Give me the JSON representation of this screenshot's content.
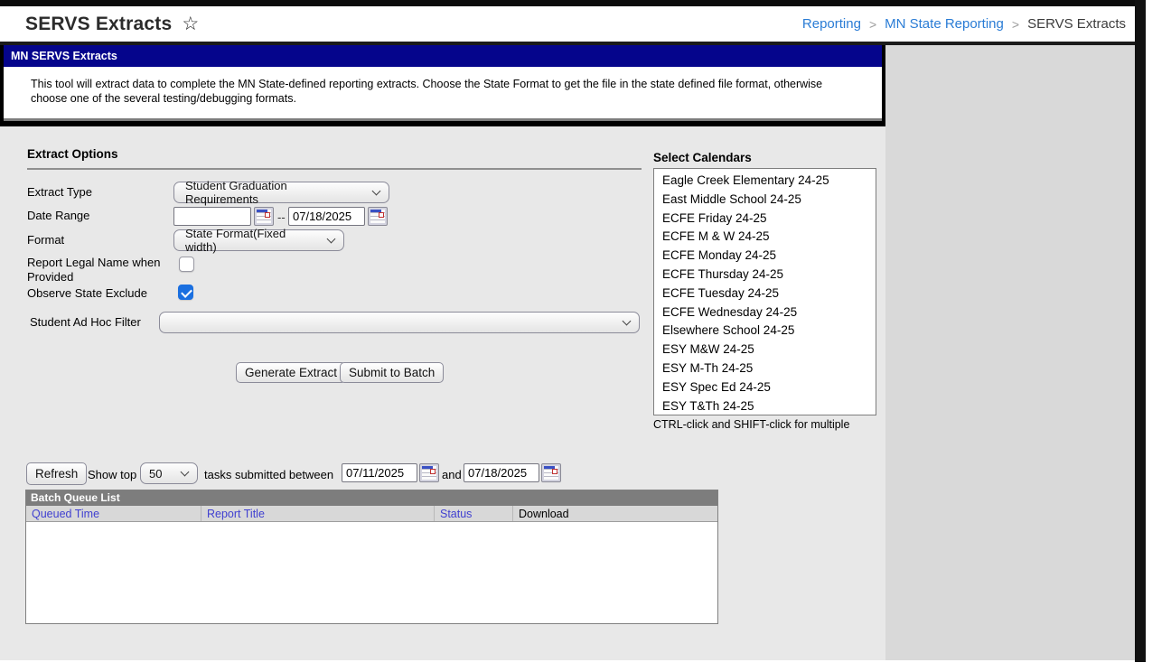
{
  "window": {
    "title": "SERVS Extracts",
    "star_icon": "☆"
  },
  "breadcrumb": {
    "items": [
      "Reporting",
      "MN State Reporting",
      "SERVS Extracts"
    ],
    "separator": ">"
  },
  "tool_header": {
    "title": "MN SERVS Extracts",
    "description": "This tool will extract data to complete the MN State-defined reporting extracts. Choose the State Format to get the file in the state defined file format, otherwise choose one of the several testing/debugging formats."
  },
  "extract_options": {
    "heading": "Extract Options",
    "extract_type": {
      "label": "Extract Type",
      "value": "Student Graduation Requirements"
    },
    "date_range": {
      "label": "Date Range",
      "start_value": "",
      "separator": "--",
      "end_value": "07/18/2025"
    },
    "format": {
      "label": "Format",
      "value": "State Format(Fixed width)"
    },
    "report_legal_name": {
      "label": "Report Legal Name when Provided",
      "checked": false
    },
    "observe_state_exclude": {
      "label": "Observe State Exclude",
      "checked": true
    },
    "ad_hoc_filter": {
      "label": "Student Ad Hoc Filter",
      "value": ""
    },
    "buttons": {
      "generate": "Generate Extract",
      "submit": "Submit to Batch"
    }
  },
  "calendars": {
    "heading": "Select Calendars",
    "items": [
      "Eagle Creek Elementary 24-25",
      "East Middle School 24-25",
      "ECFE Friday 24-25",
      "ECFE M & W 24-25",
      "ECFE Monday 24-25",
      "ECFE Thursday 24-25",
      "ECFE Tuesday 24-25",
      "ECFE Wednesday 24-25",
      "Elsewhere School 24-25",
      "ESY M&W 24-25",
      "ESY M-Th 24-25",
      "ESY Spec Ed 24-25",
      "ESY T&Th 24-25"
    ],
    "hint": "CTRL-click and SHIFT-click for multiple"
  },
  "batch_controls": {
    "refresh_label": "Refresh",
    "show_top_label": "Show top",
    "show_top_value": "50",
    "between_label": "tasks submitted between",
    "start_date": "07/11/2025",
    "and_label": "and",
    "end_date": "07/18/2025"
  },
  "batch_queue": {
    "title": "Batch Queue List",
    "columns": [
      {
        "label": "Queued Time"
      },
      {
        "label": "Report Title"
      },
      {
        "label": "Status"
      },
      {
        "label": "Download"
      }
    ],
    "rows": []
  },
  "colors": {
    "navy_bar": "#05058c",
    "breadcrumb_link": "#2a7cd5",
    "table_header_link": "#4040d0",
    "checkbox_checked": "#1a6fe0"
  }
}
